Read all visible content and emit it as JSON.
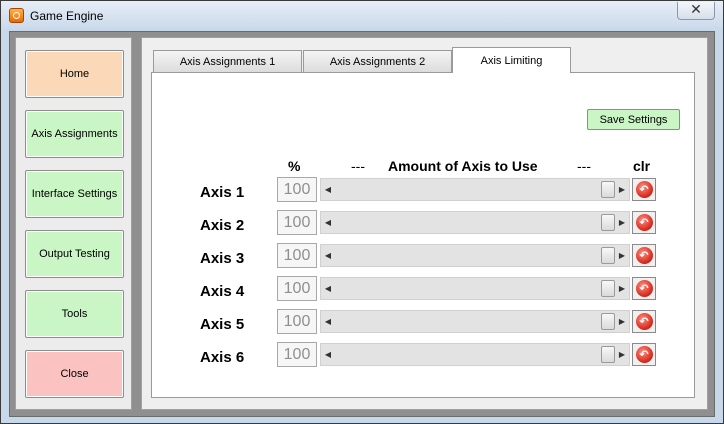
{
  "window": {
    "title": "Game Engine",
    "close_glyph": "✕"
  },
  "sidebar": {
    "items": [
      {
        "label": "Home",
        "color": "#fbd8b7"
      },
      {
        "label": "Axis Assignments",
        "color": "#c9f6c4"
      },
      {
        "label": "Interface Settings",
        "color": "#c9f6c4"
      },
      {
        "label": "Output Testing",
        "color": "#c9f6c4"
      },
      {
        "label": "Tools",
        "color": "#c9f6c4"
      },
      {
        "label": "Close",
        "color": "#fbc2c2"
      }
    ]
  },
  "tabs": [
    {
      "label": "Axis Assignments 1",
      "active": false
    },
    {
      "label": "Axis Assignments 2",
      "active": false
    },
    {
      "label": "Axis Limiting",
      "active": true
    }
  ],
  "save_button": "Save Settings",
  "headers": {
    "percent": "%",
    "dash_left": "---",
    "amount": "Amount of Axis to Use",
    "dash_right": "---",
    "clr": "clr"
  },
  "axes": [
    {
      "label": "Axis 1",
      "percent": "100",
      "slider_fraction": 1.0
    },
    {
      "label": "Axis 2",
      "percent": "100",
      "slider_fraction": 1.0
    },
    {
      "label": "Axis 3",
      "percent": "100",
      "slider_fraction": 1.0
    },
    {
      "label": "Axis 4",
      "percent": "100",
      "slider_fraction": 1.0
    },
    {
      "label": "Axis 5",
      "percent": "100",
      "slider_fraction": 1.0
    },
    {
      "label": "Axis 6",
      "percent": "100",
      "slider_fraction": 1.0
    }
  ],
  "icons": {
    "app": "app-icon",
    "clear": "undo-icon"
  }
}
